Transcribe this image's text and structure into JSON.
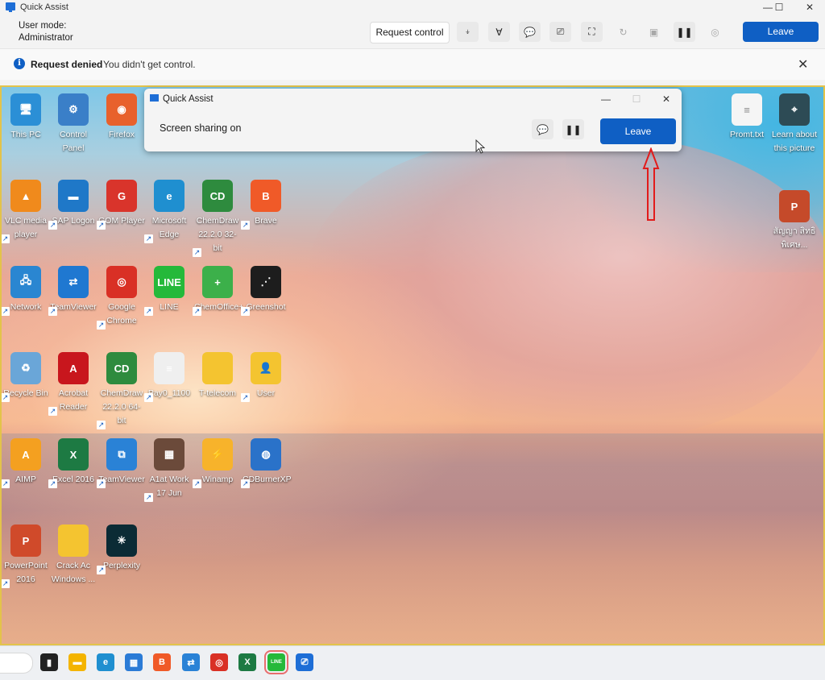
{
  "window": {
    "title": "Quick Assist",
    "controls": {
      "minimize": "—",
      "maximize": "☐",
      "close": "✕"
    }
  },
  "toolbar": {
    "user_mode_label": "User mode:",
    "user_mode_value": "Administrator",
    "request_control_label": "Request control",
    "tools": [
      {
        "icon": "laser-pointer-icon",
        "glyph": "⍖",
        "enabled": true
      },
      {
        "icon": "annotate-pen-icon",
        "glyph": "∀",
        "enabled": true
      },
      {
        "icon": "chat-icon",
        "glyph": "💬",
        "enabled": true
      },
      {
        "icon": "switch-monitor-icon",
        "glyph": "⎚",
        "enabled": true
      },
      {
        "icon": "fit-screen-icon",
        "glyph": "⛶",
        "enabled": true
      },
      {
        "icon": "restart-icon",
        "glyph": "↻",
        "enabled": false
      },
      {
        "icon": "task-manager-icon",
        "glyph": "▣",
        "enabled": false
      },
      {
        "icon": "pause-icon",
        "glyph": "❚❚",
        "enabled": true
      },
      {
        "icon": "details-icon",
        "glyph": "◎",
        "enabled": false
      }
    ],
    "leave_label": "Leave"
  },
  "notification": {
    "title": "Request denied",
    "message": "You didn't get control.",
    "close": "✕"
  },
  "remote": {
    "qa_window": {
      "title": "Quick Assist",
      "status": "Screen sharing on",
      "leave_label": "Leave",
      "controls": {
        "minimize": "—",
        "maximize": "☐",
        "close": "✕"
      }
    },
    "desktop_icons": [
      {
        "name": "This PC",
        "glyph": "🖥",
        "color": "#2b8fd6"
      },
      {
        "name": "Control Panel",
        "glyph": "⚙",
        "color": "#3a7fc8"
      },
      {
        "name": "Firefox",
        "glyph": "◉",
        "color": "#e8612c"
      },
      {
        "name": "VLC media player",
        "glyph": "▲",
        "color": "#f08a1c"
      },
      {
        "name": "SAP Logon",
        "glyph": "▬",
        "color": "#1f78c8"
      },
      {
        "name": "GOM Player",
        "glyph": "G",
        "color": "#d9342b"
      },
      {
        "name": "Microsoft Edge",
        "glyph": "e",
        "color": "#1f8fd0"
      },
      {
        "name": "ChemDraw 22.2.0 32-bit",
        "glyph": "CD",
        "color": "#2e8b3e"
      },
      {
        "name": "Brave",
        "glyph": "B",
        "color": "#f05a28"
      },
      {
        "name": "Network",
        "glyph": "🖧",
        "color": "#2a86d1"
      },
      {
        "name": "TeamViewer",
        "glyph": "⇄",
        "color": "#1f78d1"
      },
      {
        "name": "Google Chrome",
        "glyph": "◎",
        "color": "#d93025"
      },
      {
        "name": "LINE",
        "glyph": "LINE",
        "color": "#25b93a"
      },
      {
        "name": "ChemOffice+",
        "glyph": "+",
        "color": "#3cb04a"
      },
      {
        "name": "Greenshot",
        "glyph": "⋰",
        "color": "#1d1d1d"
      },
      {
        "name": "Recycle Bin",
        "glyph": "♻",
        "color": "#6aa6d8"
      },
      {
        "name": "Acrobat Reader",
        "glyph": "A",
        "color": "#c8161d"
      },
      {
        "name": "ChemDraw 22.2.0 64-bit",
        "glyph": "CD",
        "color": "#2e8b3e"
      },
      {
        "name": "Pay0_1100",
        "glyph": "≡",
        "color": "#efefef"
      },
      {
        "name": "T-telecom",
        "glyph": "",
        "color": "#f4c430"
      },
      {
        "name": "User",
        "glyph": "👤",
        "color": "#f4c430"
      },
      {
        "name": "AIMP",
        "glyph": "A",
        "color": "#f4a020"
      },
      {
        "name": "Excel 2016",
        "glyph": "X",
        "color": "#1d7a43"
      },
      {
        "name": "TeamViewer",
        "glyph": "⧉",
        "color": "#2a82d6"
      },
      {
        "name": "A1at Work 17 Jun",
        "glyph": "▦",
        "color": "#6b4a3a"
      },
      {
        "name": "Winamp",
        "glyph": "⚡",
        "color": "#f7b32b"
      },
      {
        "name": "CDBurnerXP",
        "glyph": "◍",
        "color": "#2a72c9"
      },
      {
        "name": "PowerPoint 2016",
        "glyph": "P",
        "color": "#d04a2a"
      },
      {
        "name": "Crack Ac Windows ...",
        "glyph": "",
        "color": "#f4c430"
      },
      {
        "name": "Perplexity",
        "glyph": "✳",
        "color": "#0b2b35"
      }
    ],
    "right_icons": [
      {
        "name": "Promt.txt",
        "glyph": "≡",
        "color": "#f5f5f5"
      },
      {
        "name": "Learn about this picture",
        "glyph": "⌖",
        "color": "#2d4b55"
      },
      {
        "name": "สัญญา สิทธิพิเศษ...",
        "glyph": "P",
        "color": "#c54a2a"
      }
    ]
  },
  "taskbar": {
    "apps": [
      {
        "name": "task-view",
        "glyph": "▮",
        "color": "#222"
      },
      {
        "name": "file-explorer",
        "glyph": "▬",
        "color": "#f4b400"
      },
      {
        "name": "edge",
        "glyph": "e",
        "color": "#1f8fd0"
      },
      {
        "name": "microsoft-store",
        "glyph": "▦",
        "color": "#2b7bd6"
      },
      {
        "name": "brave",
        "glyph": "B",
        "color": "#f05a28"
      },
      {
        "name": "quick-assist",
        "glyph": "⇄",
        "color": "#2a82d6"
      },
      {
        "name": "chrome",
        "glyph": "◎",
        "color": "#d93025"
      },
      {
        "name": "excel",
        "glyph": "X",
        "color": "#1d7a43"
      },
      {
        "name": "line",
        "glyph": "LINE",
        "color": "#25b93a",
        "active": true
      },
      {
        "name": "quick-assist-2",
        "glyph": "⎚",
        "color": "#1e6ed6"
      }
    ]
  }
}
